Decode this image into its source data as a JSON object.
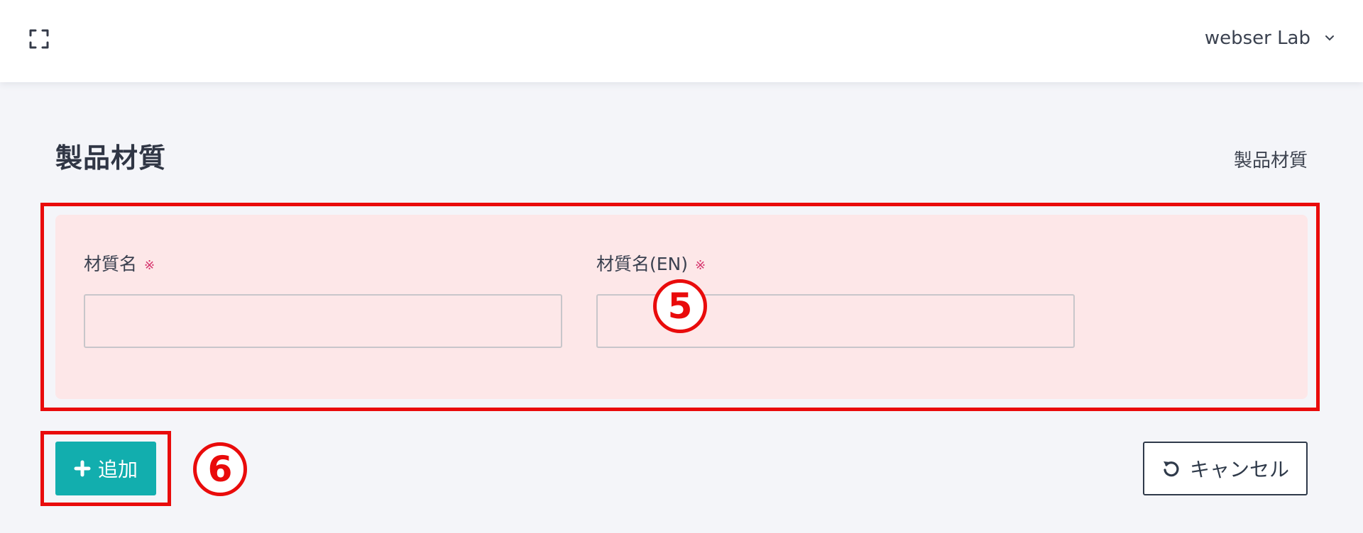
{
  "header": {
    "fullscreen_icon": "expand-icon",
    "user_name": "webser Lab",
    "user_menu_icon": "chevron-down-icon"
  },
  "page": {
    "title": "製品材質",
    "breadcrumb": "製品材質"
  },
  "form": {
    "fields": [
      {
        "label": "材質名",
        "required_mark": "※",
        "value": "",
        "placeholder": ""
      },
      {
        "label": "材質名(EN)",
        "required_mark": "※",
        "value": "",
        "placeholder": ""
      }
    ]
  },
  "annotations": {
    "form_marker": "5",
    "add_marker": "6",
    "highlight_color": "#e90b0b"
  },
  "actions": {
    "add_label": "追加",
    "add_icon": "plus-icon",
    "cancel_label": "キャンセル",
    "cancel_icon": "undo-icon"
  },
  "colors": {
    "primary": "#12aeae",
    "required": "#d6336c",
    "form_background": "#fde7e8"
  }
}
